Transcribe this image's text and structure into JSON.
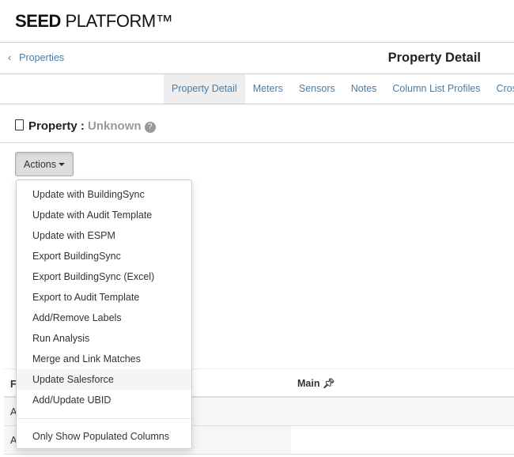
{
  "header": {
    "brand_bold": "SEED",
    "brand_rest": " PLATFORM™"
  },
  "breadcrumb": {
    "back_label": "Properties",
    "page_title": "Property Detail"
  },
  "tabs": [
    {
      "label": "Property Detail",
      "active": true
    },
    {
      "label": "Meters"
    },
    {
      "label": "Sensors"
    },
    {
      "label": "Notes"
    },
    {
      "label": "Column List Profiles"
    },
    {
      "label": "Cross"
    }
  ],
  "property": {
    "label": "Property :",
    "value": "Unknown",
    "help_icon": "question-circle-icon",
    "icon": "building-icon"
  },
  "actions": {
    "label": "Actions"
  },
  "menu": {
    "items": [
      "Update with BuildingSync",
      "Update with Audit Template",
      "Update with ESPM",
      "Export BuildingSync",
      "Export BuildingSync (Excel)",
      "Export to Audit Template",
      "Add/Remove Labels",
      "Run Analysis",
      "Merge and Link Matches",
      "Update Salesforce",
      "Add/Update UBID"
    ],
    "hovered": "Update Salesforce",
    "footer_item": "Only Show Populated Columns"
  },
  "table": {
    "headers": [
      "F",
      "Main"
    ],
    "rows": [
      "A",
      "A"
    ]
  }
}
